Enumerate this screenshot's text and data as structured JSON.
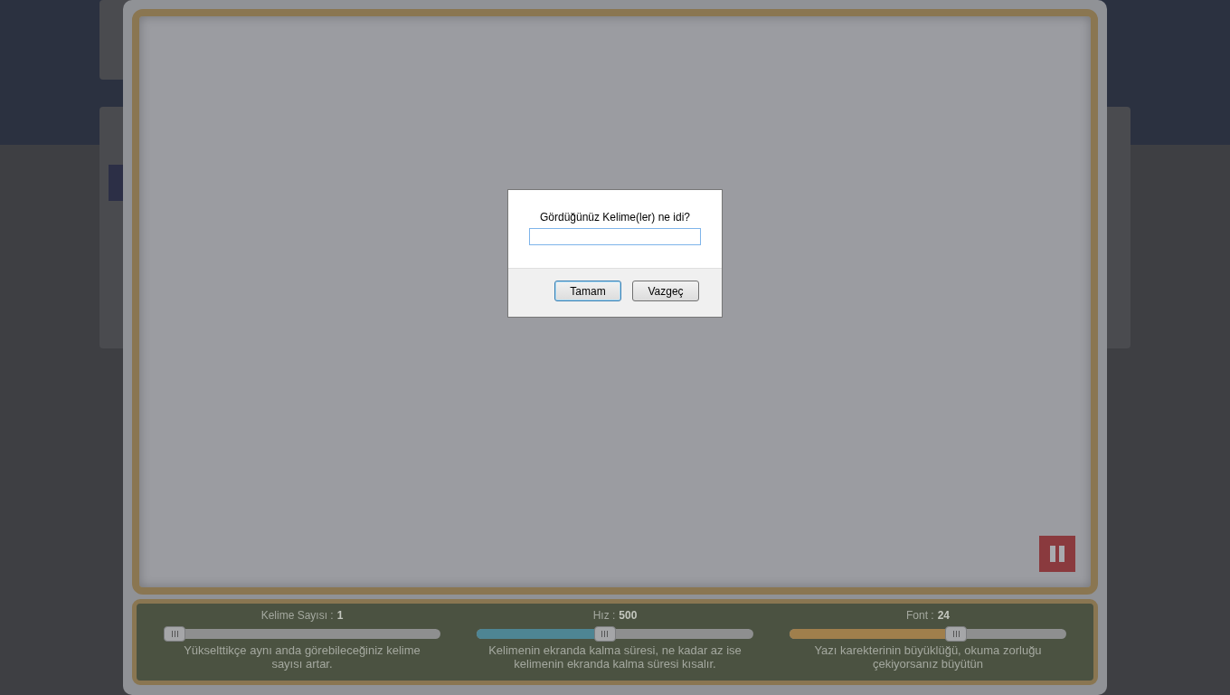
{
  "dialog": {
    "prompt": "Gördüğünüz Kelime(ler) ne idi?",
    "answer_focused": true,
    "buttons": [
      {
        "label": "Tamam",
        "default": true
      },
      {
        "label": "Vazgeç",
        "default": false
      }
    ]
  },
  "sliders": [
    {
      "label": "Kelime Sayısı :",
      "value": "1",
      "level": 0,
      "description": "Yükselttikçe aynı anda görebileceğiniz kelime sayısı artar."
    },
    {
      "label": "Hız :",
      "value": "500",
      "level": 0.46,
      "color": "#4e8593",
      "description": "Kelimenin ekranda kalma süresi, ne kadar az ise kelimenin ekranda kalma süresi kısalır."
    },
    {
      "label": "Font :",
      "value": "24",
      "level": 0.61,
      "color": "#a07f4c",
      "description": "Yazı karekterinin büyüklüğü, okuma zorluğu çekiyorsanız büyütün"
    }
  ]
}
